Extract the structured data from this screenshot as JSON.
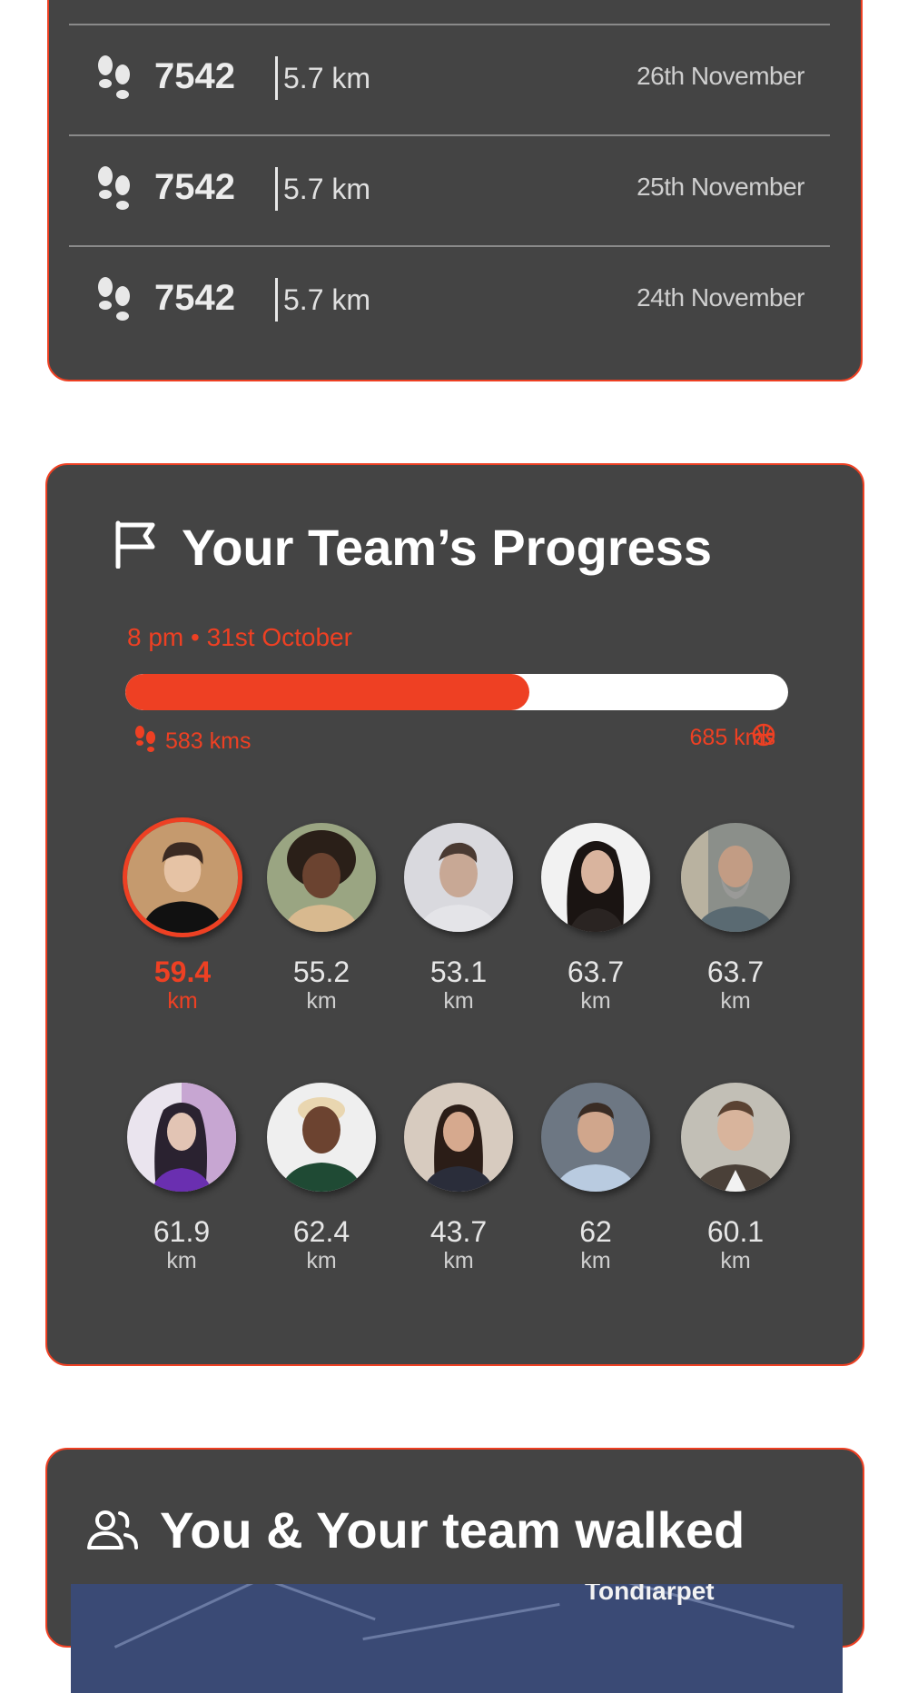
{
  "history": {
    "rows": [
      {
        "steps": "7542",
        "distance": "5.7 km",
        "date": "26th November"
      },
      {
        "steps": "7542",
        "distance": "5.7 km",
        "date": "25th November"
      },
      {
        "steps": "7542",
        "distance": "5.7 km",
        "date": "24th November"
      }
    ]
  },
  "team": {
    "title": "Your Team’s Progress",
    "timestamp": "8 pm • 31st October",
    "progress": {
      "current": "583 kms",
      "goal": "685 kms",
      "fraction": 0.61
    },
    "members": [
      {
        "value": "59.4",
        "unit": "km",
        "active": true
      },
      {
        "value": "55.2",
        "unit": "km"
      },
      {
        "value": "53.1",
        "unit": "km"
      },
      {
        "value": "63.7",
        "unit": "km"
      },
      {
        "value": "63.7",
        "unit": "km"
      },
      {
        "value": "61.9",
        "unit": "km"
      },
      {
        "value": "62.4",
        "unit": "km"
      },
      {
        "value": "43.7",
        "unit": "km"
      },
      {
        "value": "62",
        "unit": "km"
      },
      {
        "value": "60.1",
        "unit": "km"
      }
    ]
  },
  "walked": {
    "title": "You & Your team walked",
    "map_label": "Tondiarpet"
  },
  "colors": {
    "accent": "#ee4023",
    "card": "#444444"
  },
  "icons": [
    "footprints-icon",
    "flag-icon",
    "basketball-icon",
    "people-icon"
  ]
}
